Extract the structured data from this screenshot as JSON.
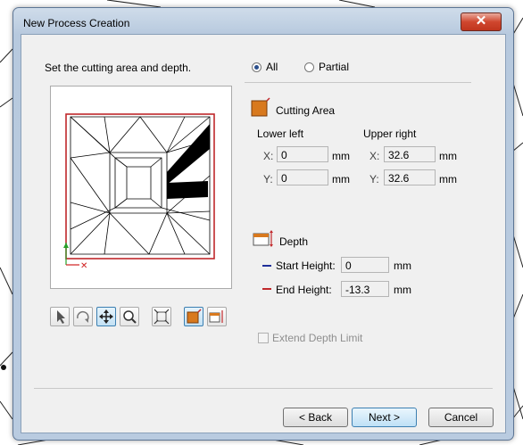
{
  "window": {
    "title": "New Process Creation",
    "close_glyph": "✕"
  },
  "instruction": "Set the cutting area and depth.",
  "mode": {
    "options": [
      {
        "label": "All",
        "selected": true
      },
      {
        "label": "Partial",
        "selected": false
      }
    ]
  },
  "cutting_area": {
    "heading": "Cutting Area",
    "icon": "cutting-area-icon",
    "lower_left": {
      "label": "Lower left",
      "x_label": "X:",
      "x": "0",
      "y_label": "Y:",
      "y": "0",
      "unit": "mm"
    },
    "upper_right": {
      "label": "Upper right",
      "x_label": "X:",
      "x": "32.6",
      "y_label": "Y:",
      "y": "32.6",
      "unit": "mm"
    }
  },
  "depth": {
    "heading": "Depth",
    "icon": "depth-icon",
    "start": {
      "label": "Start Height:",
      "value": "0",
      "unit": "mm",
      "color": "#1f2f9a"
    },
    "end": {
      "label": "End Height:",
      "value": "-13.3",
      "unit": "mm",
      "color": "#c0282b"
    }
  },
  "extend_depth_limit": {
    "label": "Extend Depth Limit",
    "checked": false,
    "enabled": false
  },
  "toolbar": [
    "select-arrow-icon",
    "rotate-icon",
    "pan-icon",
    "zoom-icon",
    "fit-icon",
    "cutting-area-tool-icon",
    "depth-tool-icon"
  ],
  "buttons": {
    "back": "< Back",
    "next": "Next >",
    "cancel": "Cancel"
  },
  "colors": {
    "accent_orange": "#d8791e",
    "area_red": "#c0282b",
    "axis_green": "#28a028",
    "axis_red": "#d02020"
  }
}
